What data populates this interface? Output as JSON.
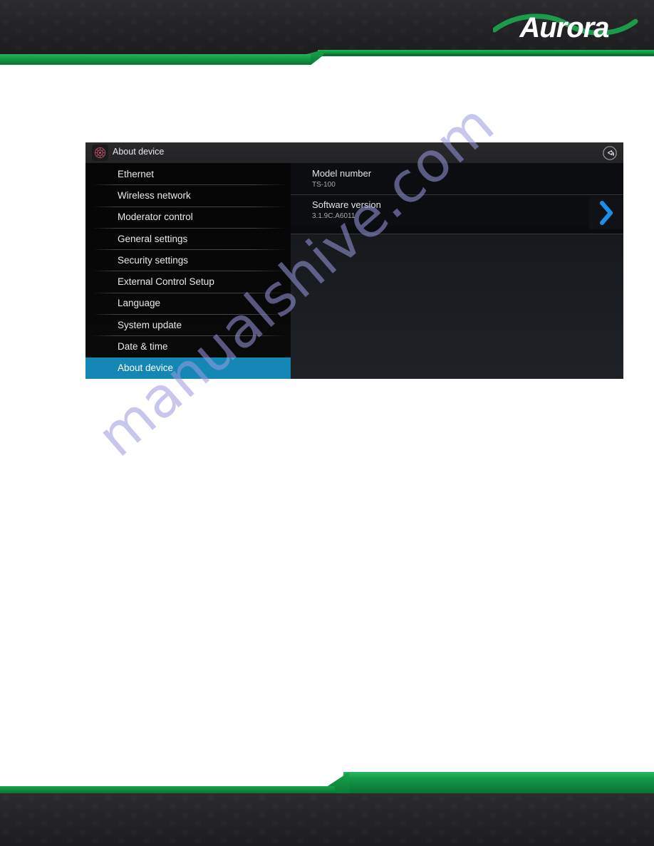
{
  "page": {
    "brand_logo_text": "Aurora",
    "brand_green": "#0e9040",
    "watermark_text": "manualshive.com",
    "watermark_color": "#9b9be0"
  },
  "device_panel": {
    "title_bar": {
      "icon": "settings-gear-icon",
      "title": "About device",
      "back_icon": "circular-back-arrow-icon"
    },
    "sidebar": {
      "items": [
        {
          "label": "Ethernet",
          "selected": false
        },
        {
          "label": "Wireless network",
          "selected": false
        },
        {
          "label": "Moderator control",
          "selected": false
        },
        {
          "label": "General settings",
          "selected": false
        },
        {
          "label": "Security settings",
          "selected": false
        },
        {
          "label": "External Control Setup",
          "selected": false
        },
        {
          "label": "Language",
          "selected": false
        },
        {
          "label": "System update",
          "selected": false
        },
        {
          "label": "Date & time",
          "selected": false
        },
        {
          "label": "About device",
          "selected": true
        }
      ],
      "selected_color": "#1587b5"
    },
    "content": {
      "rows": [
        {
          "title": "Model number",
          "value": "TS-100"
        },
        {
          "title": "Software version",
          "value": "3.1.9C.A6011"
        }
      ],
      "chevron_icon": "chevron-right-icon",
      "chevron_color": "#1e8fe8"
    },
    "floating_buttons": [
      {
        "name": "close-button",
        "icon": "circle-x-icon",
        "color": "#c0394b"
      },
      {
        "name": "home-button",
        "icon": "home-icon",
        "color": "#d8d8d8"
      },
      {
        "name": "back-button",
        "icon": "chevron-left-icon",
        "color": "#f0f0f0"
      },
      {
        "name": "return-button",
        "icon": "return-arrow-icon",
        "color": "#d8d8d8"
      }
    ]
  }
}
